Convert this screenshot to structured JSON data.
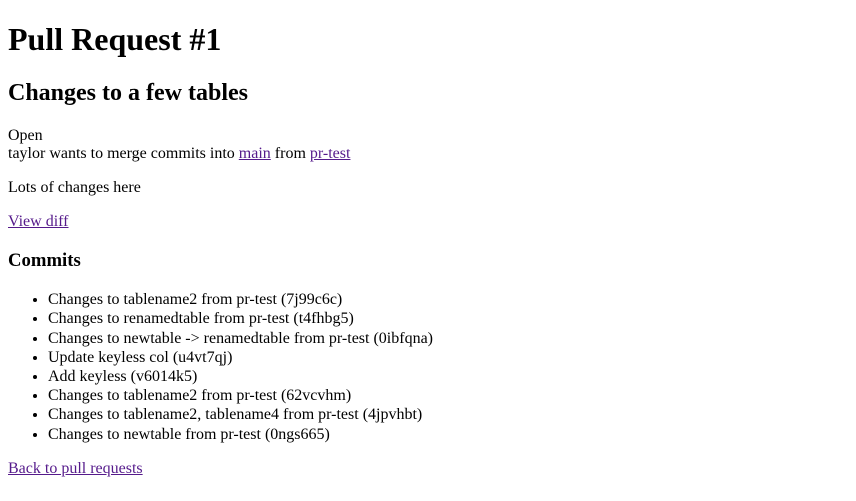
{
  "page_title": "Pull Request #1",
  "pr_title": "Changes to a few tables",
  "status": "Open",
  "merge_text_prefix": "taylor wants to merge commits into ",
  "target_branch": "main",
  "merge_text_middle": " from ",
  "source_branch": "pr-test",
  "description": "Lots of changes here",
  "view_diff_label": "View diff",
  "commits_heading": "Commits",
  "commits": [
    "Changes to tablename2 from pr-test (7j99c6c)",
    "Changes to renamedtable from pr-test (t4fhbg5)",
    "Changes to newtable -> renamedtable from pr-test (0ibfqna)",
    "Update keyless col (u4vt7qj)",
    "Add keyless (v6014k5)",
    "Changes to tablename2 from pr-test (62vcvhm)",
    "Changes to tablename2, tablename4 from pr-test (4jpvhbt)",
    "Changes to newtable from pr-test (0ngs665)"
  ],
  "back_link_label": "Back to pull requests"
}
